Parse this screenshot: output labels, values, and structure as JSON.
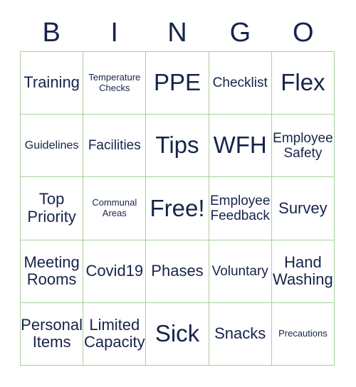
{
  "card": {
    "title": "BINGO",
    "header_letters": [
      "B",
      "I",
      "N",
      "G",
      "O"
    ],
    "colors": {
      "text": "#16244a",
      "grid_border": "#a9cfa0",
      "background": "#ffffff"
    },
    "grid": {
      "columns": 5,
      "rows": 5,
      "free_space": "Free!",
      "free_space_position": "center"
    },
    "cells": [
      {
        "label": "Training",
        "size": "lg",
        "column": "B",
        "row": 1
      },
      {
        "label": "Temperature\nChecks",
        "size": "xs",
        "column": "I",
        "row": 1
      },
      {
        "label": "PPE",
        "size": "xxl",
        "column": "N",
        "row": 1
      },
      {
        "label": "Checklist",
        "size": "md",
        "column": "G",
        "row": 1
      },
      {
        "label": "Flex",
        "size": "xxl",
        "column": "O",
        "row": 1
      },
      {
        "label": "Guidelines",
        "size": "sm",
        "column": "B",
        "row": 2
      },
      {
        "label": "Facilities",
        "size": "md",
        "column": "I",
        "row": 2
      },
      {
        "label": "Tips",
        "size": "xxl",
        "column": "N",
        "row": 2
      },
      {
        "label": "WFH",
        "size": "xxl",
        "column": "G",
        "row": 2
      },
      {
        "label": "Employee\nSafety",
        "size": "md",
        "column": "O",
        "row": 2
      },
      {
        "label": "Top\nPriority",
        "size": "lg",
        "column": "B",
        "row": 3
      },
      {
        "label": "Communal\nAreas",
        "size": "xs",
        "column": "I",
        "row": 3
      },
      {
        "label": "Free!",
        "size": "xxl",
        "column": "N",
        "row": 3
      },
      {
        "label": "Employee\nFeedback",
        "size": "md",
        "column": "G",
        "row": 3
      },
      {
        "label": "Survey",
        "size": "lg",
        "column": "O",
        "row": 3
      },
      {
        "label": "Meeting\nRooms",
        "size": "lg",
        "column": "B",
        "row": 4
      },
      {
        "label": "Covid19",
        "size": "lg",
        "column": "I",
        "row": 4
      },
      {
        "label": "Phases",
        "size": "lg",
        "column": "N",
        "row": 4
      },
      {
        "label": "Voluntary",
        "size": "md",
        "column": "G",
        "row": 4
      },
      {
        "label": "Hand\nWashing",
        "size": "lg",
        "column": "O",
        "row": 4
      },
      {
        "label": "Personal\nItems",
        "size": "lg",
        "column": "B",
        "row": 5
      },
      {
        "label": "Limited\nCapacity",
        "size": "lg",
        "column": "I",
        "row": 5
      },
      {
        "label": "Sick",
        "size": "xxl",
        "column": "N",
        "row": 5
      },
      {
        "label": "Snacks",
        "size": "lg",
        "column": "G",
        "row": 5
      },
      {
        "label": "Precautions",
        "size": "xs",
        "column": "O",
        "row": 5
      }
    ]
  }
}
